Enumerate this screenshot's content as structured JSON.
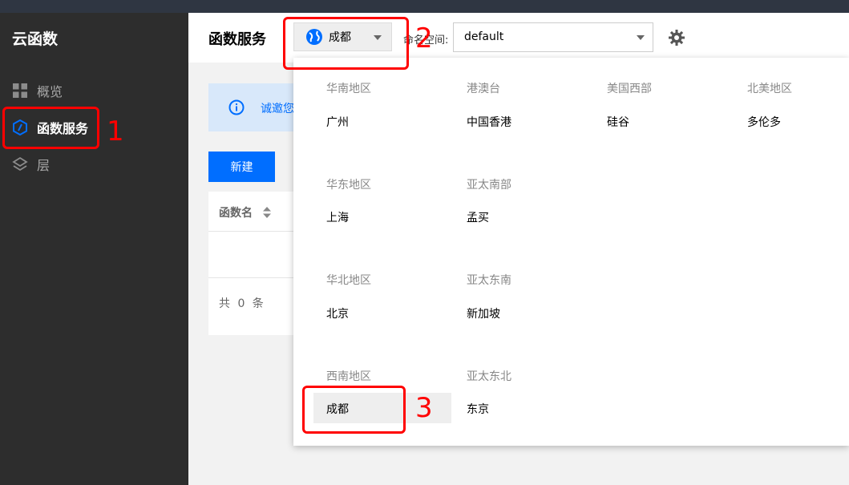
{
  "sidebar": {
    "title": "云函数",
    "items": [
      {
        "label": "概览",
        "icon": "grid-icon"
      },
      {
        "label": "函数服务",
        "icon": "function-hexagon-icon"
      },
      {
        "label": "层",
        "icon": "layers-icon"
      }
    ]
  },
  "header": {
    "title": "函数服务",
    "region": "成都",
    "namespace_label": "命名空间:",
    "namespace_value": "default"
  },
  "notice": {
    "text": "诚邀您"
  },
  "toolbar": {
    "new_label": "新建"
  },
  "table": {
    "columns": [
      "函数名"
    ],
    "footer": "共 0 条"
  },
  "region_dropdown": {
    "groups": [
      {
        "name": "华南地区",
        "options": [
          "广州"
        ]
      },
      {
        "name": "港澳台",
        "options": [
          "中国香港"
        ]
      },
      {
        "name": "美国西部",
        "options": [
          "硅谷"
        ]
      },
      {
        "name": "北美地区",
        "options": [
          "多伦多"
        ]
      },
      {
        "name": "华东地区",
        "options": [
          "上海"
        ]
      },
      {
        "name": "亚太南部",
        "options": [
          "孟买"
        ]
      },
      {
        "name": "华北地区",
        "options": [
          "北京"
        ]
      },
      {
        "name": "亚太东南",
        "options": [
          "新加坡"
        ]
      },
      {
        "name": "西南地区",
        "options": [
          "成都"
        ]
      },
      {
        "name": "亚太东北",
        "options": [
          "东京"
        ]
      }
    ],
    "selected": "成都"
  },
  "annotations": [
    "1",
    "2",
    "3"
  ],
  "colors": {
    "accent": "#006eff",
    "annotation": "#ff0000",
    "sidebar": "#2d2d2d"
  }
}
